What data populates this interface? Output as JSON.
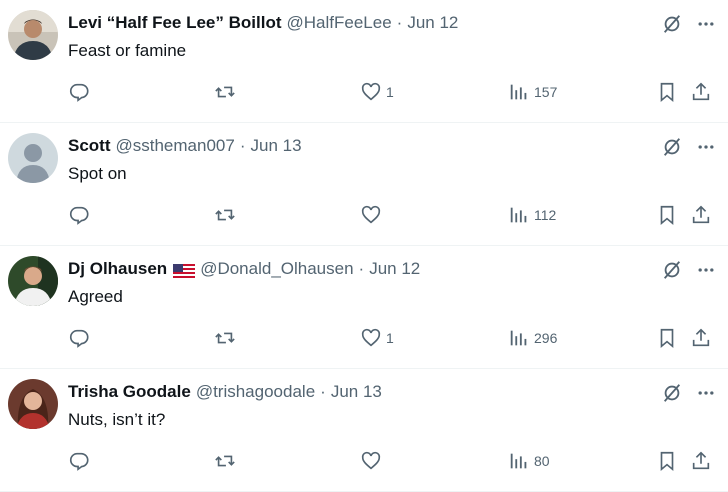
{
  "colors": {
    "muted": "#536471",
    "text": "#0f1419",
    "border": "#eff3f4"
  },
  "tweets": [
    {
      "name": "Levi “Half Fee Lee” Boillot",
      "handle": "@HalfFeeLee",
      "dot": "·",
      "date": "Jun 12",
      "text": "Feast or famine",
      "likes": "1",
      "views": "157",
      "avatar": "man-photo-avatar"
    },
    {
      "name": "Scott",
      "handle": "@sstheman007",
      "dot": "·",
      "date": "Jun 13",
      "text": "Spot on",
      "likes": "",
      "views": "112",
      "avatar": "default-profile-avatar"
    },
    {
      "name": "Dj Olhausen",
      "handle": "@Donald_Olhausen",
      "dot": "·",
      "date": "Jun 12",
      "text": "Agreed",
      "likes": "1",
      "views": "296",
      "avatar": "man-photo-avatar",
      "flag": "us-flag-icon"
    },
    {
      "name": "Trisha Goodale",
      "handle": "@trishagoodale",
      "dot": "·",
      "date": "Jun 13",
      "text": "Nuts, isn’t it?",
      "likes": "",
      "views": "80",
      "avatar": "woman-photo-avatar"
    }
  ]
}
